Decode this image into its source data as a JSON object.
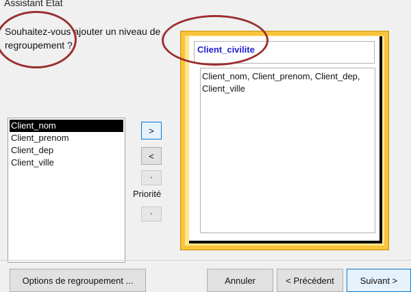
{
  "window": {
    "title": "Assistant État"
  },
  "prompt": {
    "question": "Souhaitez-vous ajouter un niveau de regroupement ?"
  },
  "fields": [
    "Client_nom",
    "Client_prenom",
    "Client_dep",
    "Client_ville"
  ],
  "selected_field": "Client_nom",
  "move_buttons": {
    "add": ">",
    "remove": "<",
    "up": "•",
    "down": "•",
    "priority_label": "Priorité"
  },
  "preview": {
    "group_header": "Client_civilite",
    "detail_fields": "Client_nom, Client_prenom, Client_dep, Client_ville"
  },
  "footer": {
    "options_label": "Options de regroupement ...",
    "cancel_label": "Annuler",
    "back_label": "< Précédent",
    "next_label": "Suivant >"
  },
  "colors": {
    "group_header_text": "#1f1fd2",
    "preview_frame": "#f9c33b",
    "annotation_circle": "#9b2f2f"
  }
}
